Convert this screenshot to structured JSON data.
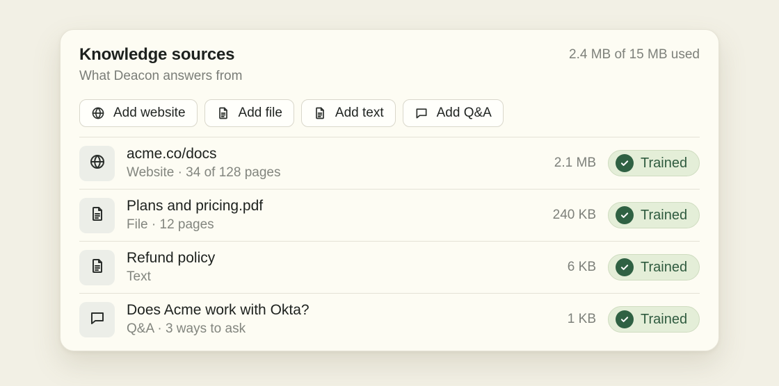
{
  "header": {
    "title": "Knowledge sources",
    "subtitle": "What Deacon answers from",
    "usage": "2.4 MB of 15 MB used"
  },
  "actions": [
    {
      "label": "Add website",
      "icon": "globe-icon"
    },
    {
      "label": "Add file",
      "icon": "file-icon"
    },
    {
      "label": "Add text",
      "icon": "text-doc-icon"
    },
    {
      "label": "Add Q&A",
      "icon": "chat-icon"
    }
  ],
  "sources": [
    {
      "name": "acme.co/docs",
      "meta": "Website · 34 of 128 pages",
      "size": "2.1 MB",
      "status": "Trained",
      "icon": "globe-icon"
    },
    {
      "name": "Plans and pricing.pdf",
      "meta": "File · 12 pages",
      "size": "240 KB",
      "status": "Trained",
      "icon": "file-icon"
    },
    {
      "name": "Refund policy",
      "meta": "Text",
      "size": "6 KB",
      "status": "Trained",
      "icon": "text-doc-icon"
    },
    {
      "name": "Does Acme work with Okta?",
      "meta": "Q&A · 3 ways to ask",
      "size": "1 KB",
      "status": "Trained",
      "icon": "chat-icon"
    }
  ],
  "colors": {
    "background": "#f2f0e5",
    "card": "#fdfcf3",
    "badge_bg": "#e4eed8",
    "badge_check": "#2f6143",
    "badge_text": "#2f5b3f"
  }
}
